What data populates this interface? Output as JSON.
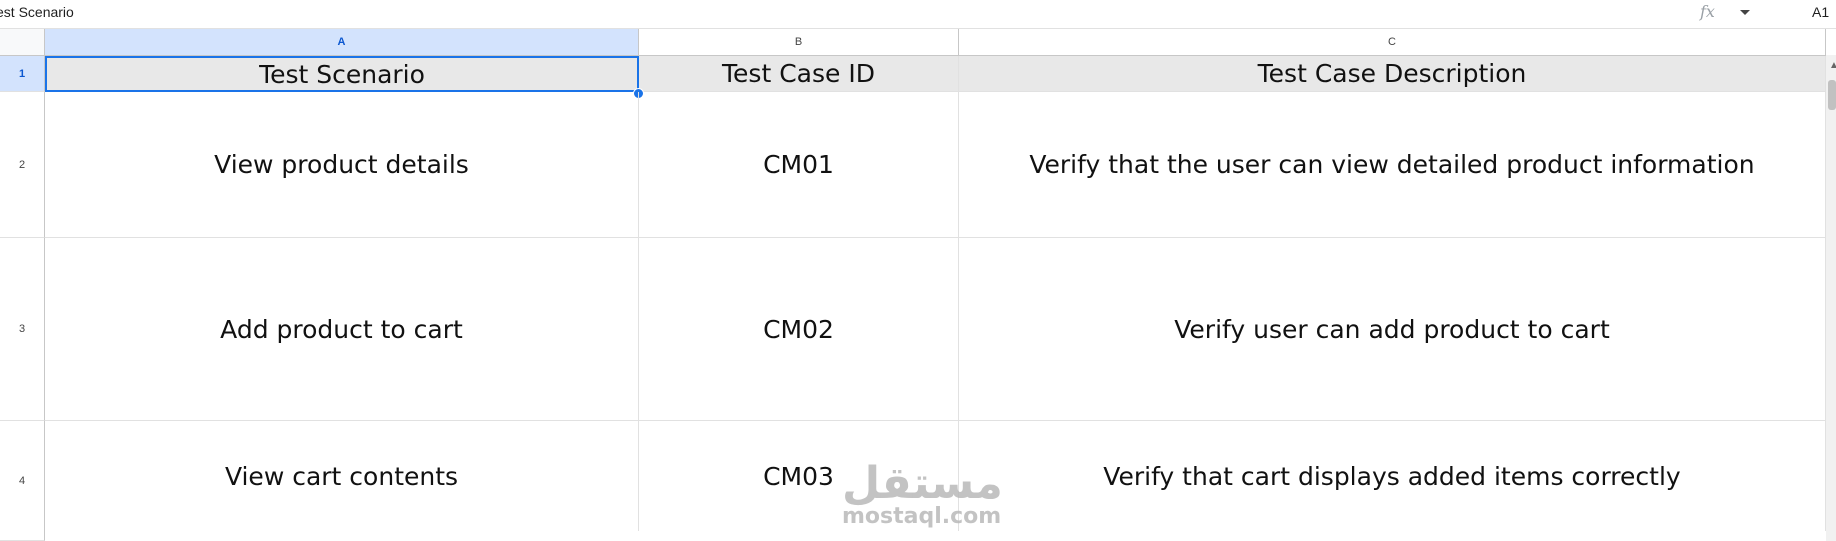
{
  "formula_bar": {
    "cell_content": "est Scenario",
    "fx_icon": "fx-icon",
    "dropdown_icon": "chevron-down-icon",
    "cell_reference": "A1"
  },
  "columns": [
    {
      "letter": "A",
      "selected": true
    },
    {
      "letter": "B",
      "selected": false
    },
    {
      "letter": "C",
      "selected": false
    }
  ],
  "rows": [
    {
      "number": "1",
      "cells": [
        "Test Scenario",
        "Test Case ID",
        "Test Case Description"
      ]
    },
    {
      "number": "2",
      "cells": [
        "View product details",
        "CM01",
        "Verify that the user can view detailed product information"
      ]
    },
    {
      "number": "3",
      "cells": [
        "Add product to cart",
        "CM02",
        "Verify user can add product to cart"
      ]
    },
    {
      "number": "4",
      "cells": [
        "View cart contents",
        "CM03",
        "Verify that cart displays added items correctly"
      ]
    }
  ],
  "watermark": {
    "arabic": "مستقل",
    "latin": "mostaql.com"
  },
  "colors": {
    "selection": "#1a73e8",
    "header_fill": "#e8e8e8",
    "selected_header": "#d3e3fd"
  }
}
